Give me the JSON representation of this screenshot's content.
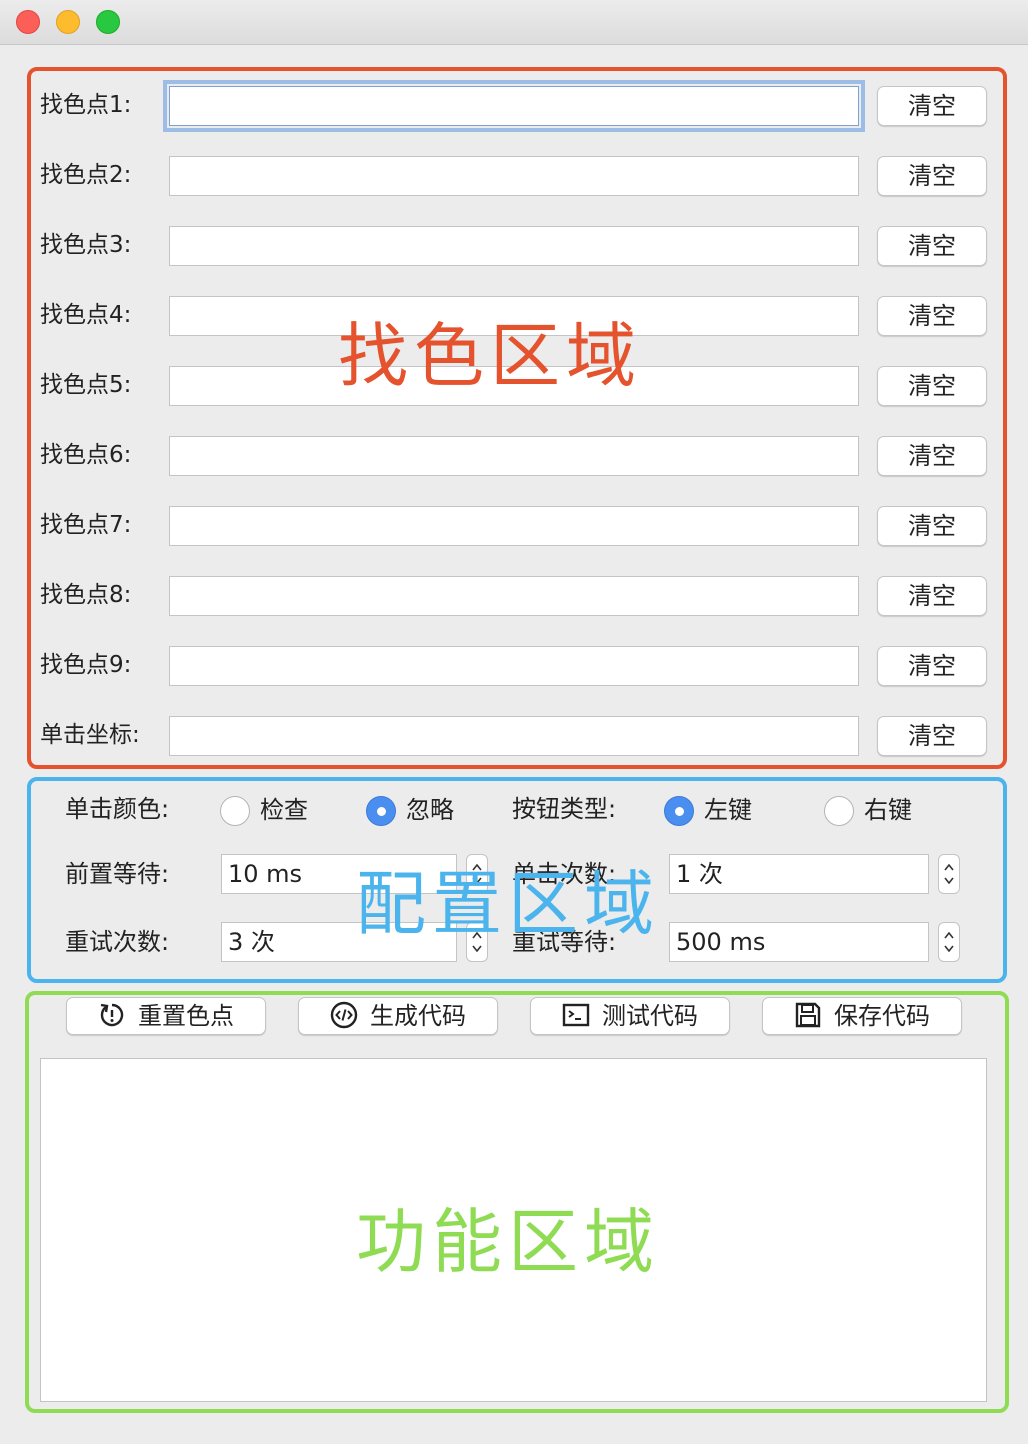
{
  "find_color": {
    "rows": [
      {
        "label": "找色点1:",
        "value": ""
      },
      {
        "label": "找色点2:",
        "value": ""
      },
      {
        "label": "找色点3:",
        "value": ""
      },
      {
        "label": "找色点4:",
        "value": ""
      },
      {
        "label": "找色点5:",
        "value": ""
      },
      {
        "label": "找色点6:",
        "value": ""
      },
      {
        "label": "找色点7:",
        "value": ""
      },
      {
        "label": "找色点8:",
        "value": ""
      },
      {
        "label": "找色点9:",
        "value": ""
      },
      {
        "label": "单击坐标:",
        "value": ""
      }
    ],
    "clear_label": "清空",
    "watermark": "找色区域",
    "accent": "#e5532e"
  },
  "config": {
    "click_color_label": "单击颜色:",
    "check_label": "检查",
    "ignore_label": "忽略",
    "button_type_label": "按钮类型:",
    "left_key_label": "左键",
    "right_key_label": "右键",
    "pre_wait_label": "前置等待:",
    "pre_wait_value": "10 ms",
    "click_count_label": "单击次数:",
    "click_count_value": "1 次",
    "retry_count_label": "重试次数:",
    "retry_count_value": "3 次",
    "retry_wait_label": "重试等待:",
    "retry_wait_value": "500 ms",
    "click_color_selected": "忽略",
    "button_type_selected": "左键",
    "watermark": "配置区域",
    "accent": "#4cb4ec"
  },
  "functions": {
    "buttons": [
      {
        "label": "重置色点",
        "icon": "reset-icon"
      },
      {
        "label": "生成代码",
        "icon": "code-icon"
      },
      {
        "label": "测试代码",
        "icon": "terminal-icon"
      },
      {
        "label": "保存代码",
        "icon": "save-icon"
      }
    ],
    "output_text": "",
    "watermark": "功能区域",
    "accent": "#8fdc54"
  }
}
